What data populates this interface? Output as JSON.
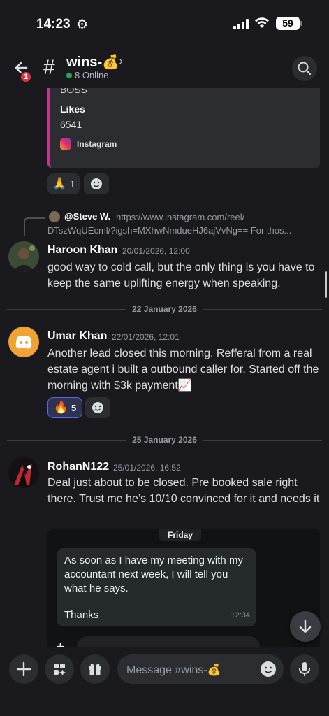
{
  "status_bar": {
    "time": "14:23",
    "battery": "59"
  },
  "header": {
    "back_badge": "1",
    "channel_name": "wins-💰",
    "online": "8 Online"
  },
  "embed": {
    "line1": "BOSS",
    "likes_label": "Likes",
    "likes_value": "6541",
    "source": "Instagram"
  },
  "reactions_1": {
    "emoji": "🙏",
    "count": "1"
  },
  "messages": [
    {
      "reply": {
        "name": "@Steve W.",
        "text": "https://www.instagram.com/reel/",
        "text2": "DTszWqUEcml/?igsh=MXhwNmdueHJ6ajVvNg==   For thos..."
      },
      "author": "Haroon Khan",
      "timestamp": "20/01/2026, 12:00",
      "text": "good way to cold call, but the only thing is you have to keep the same uplifting energy when speaking."
    },
    {
      "author": "Umar Khan",
      "timestamp": "22/01/2026, 12:01",
      "text": "Another lead closed this morning. Refferal from a real estate agent i built a outbound caller for. Started off the morning with $3k payment📈",
      "reaction": {
        "emoji": "🔥",
        "count": "5"
      }
    },
    {
      "author": "RohanN122",
      "timestamp": "25/01/2026, 16:52",
      "text": "Deal just about to be closed. Pre booked sale right there. Trust me he’s 10/10 convinced for it and needs it"
    }
  ],
  "dividers": [
    "22 January 2026",
    "25 January 2026"
  ],
  "screenshot": {
    "day": "Friday",
    "bubble_text": "As soon as I have my meeting with my accountant next week, I will tell you what he says.",
    "thanks": "Thanks",
    "time": "12:34"
  },
  "composer": {
    "placeholder": "Message #wins-💰"
  },
  "colors": {
    "accent": "#5865f2",
    "online": "#23a55a",
    "badge": "#e03340",
    "embed_bar": "#c1358a",
    "discord_avatar": "#f0a232"
  }
}
